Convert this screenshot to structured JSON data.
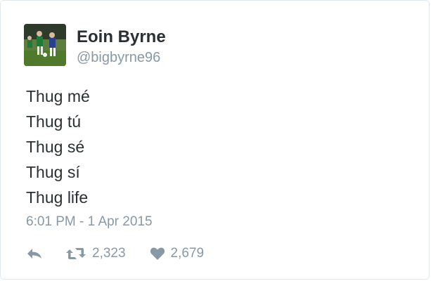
{
  "tweet": {
    "author": {
      "name": "Eoin Byrne",
      "handle": "@bigbyrne96"
    },
    "lines": [
      "Thug mé",
      "Thug tú",
      "Thug sé",
      "Thug sí",
      "Thug life"
    ],
    "timestamp": "6:01 PM - 1 Apr 2015",
    "actions": {
      "reply_icon": "reply-icon",
      "retweet_icon": "retweet-icon",
      "retweet_count": "2,323",
      "like_icon": "heart-icon",
      "like_count": "2,679"
    }
  },
  "colors": {
    "text": "#292f33",
    "muted": "#8899a6",
    "border": "#e1e8ed"
  }
}
